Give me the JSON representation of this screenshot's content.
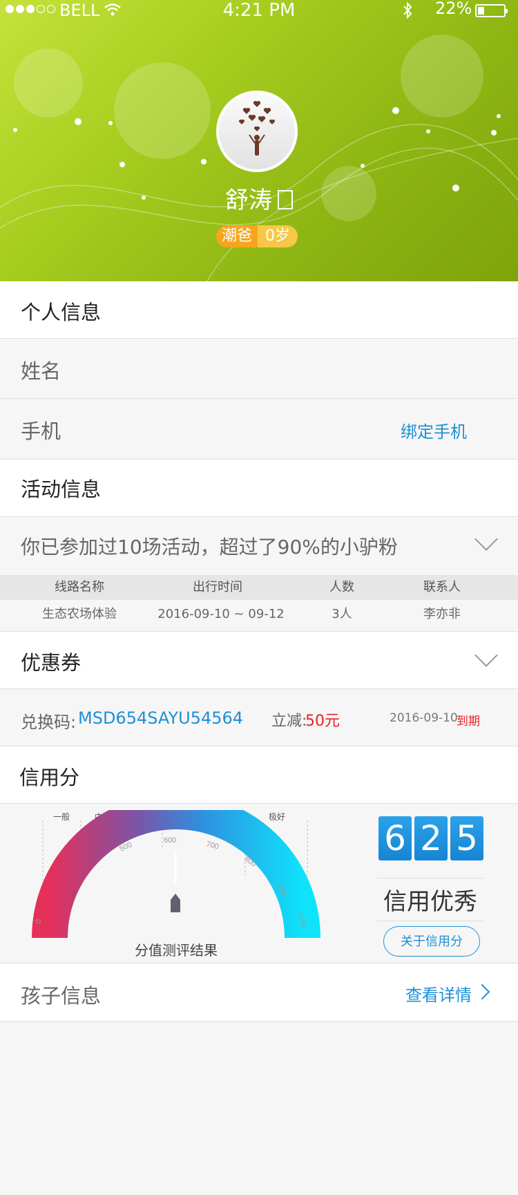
{
  "status_bar": {
    "carrier": "BELL",
    "time": "4:21 PM",
    "battery": "22%"
  },
  "profile": {
    "name": "舒涛",
    "role": "潮爸",
    "age": "0岁"
  },
  "personal": {
    "title": "个人信息",
    "name_label": "姓名",
    "phone_label": "手机",
    "bind_phone": "绑定手机"
  },
  "activity": {
    "title": "活动信息",
    "summary": "你已参加过10场活动，超过了90%的小驴粉",
    "columns": [
      "线路名称",
      "出行时间",
      "人数",
      "联系人"
    ],
    "rows": [
      [
        "生态农场体验",
        "2016-09-10 ~ 09-12",
        "3人",
        "李亦非"
      ]
    ]
  },
  "coupon": {
    "title": "优惠券",
    "code_label": "兑换码:",
    "code": "MSD654SAYU54564",
    "discount_label": "立减:",
    "discount": "50元",
    "expire_date": "2016-09-10",
    "expire_label": "到期"
  },
  "credit": {
    "title": "信用分",
    "levels": [
      "一般",
      "中等",
      "良好",
      "优秀",
      "极好"
    ],
    "ticks": [
      "0",
      "500",
      "600",
      "700",
      "800",
      "900",
      "1000"
    ],
    "caption": "分值测评结果",
    "digits": [
      "6",
      "2",
      "5"
    ],
    "score": 625,
    "rating": "信用优秀",
    "about_button": "关于信用分"
  },
  "child": {
    "title": "孩子信息",
    "details": "查看详情"
  },
  "colors": {
    "accent": "#1e8fd6",
    "danger": "#e8202a",
    "badge_orange": "#f7a51c",
    "header_green": "#8cb412"
  }
}
